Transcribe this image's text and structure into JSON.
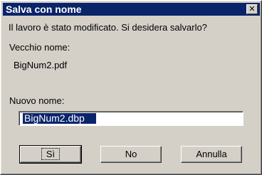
{
  "dialog": {
    "title": "Salva con nome",
    "close_glyph": "✕",
    "message": "Il lavoro è stato modificato. Si desidera salvarlo?",
    "old_name_label": "Vecchio nome:",
    "old_name_value": "BigNum2.pdf",
    "new_name_label": "Nuovo nome:",
    "new_name_value": "BigNum2.dbp",
    "buttons": {
      "yes": "Sì",
      "no": "No",
      "cancel": "Annulla"
    }
  },
  "colors": {
    "titlebar": "#0a246a",
    "face": "#d4d0c8",
    "selection": "#0a246a"
  }
}
